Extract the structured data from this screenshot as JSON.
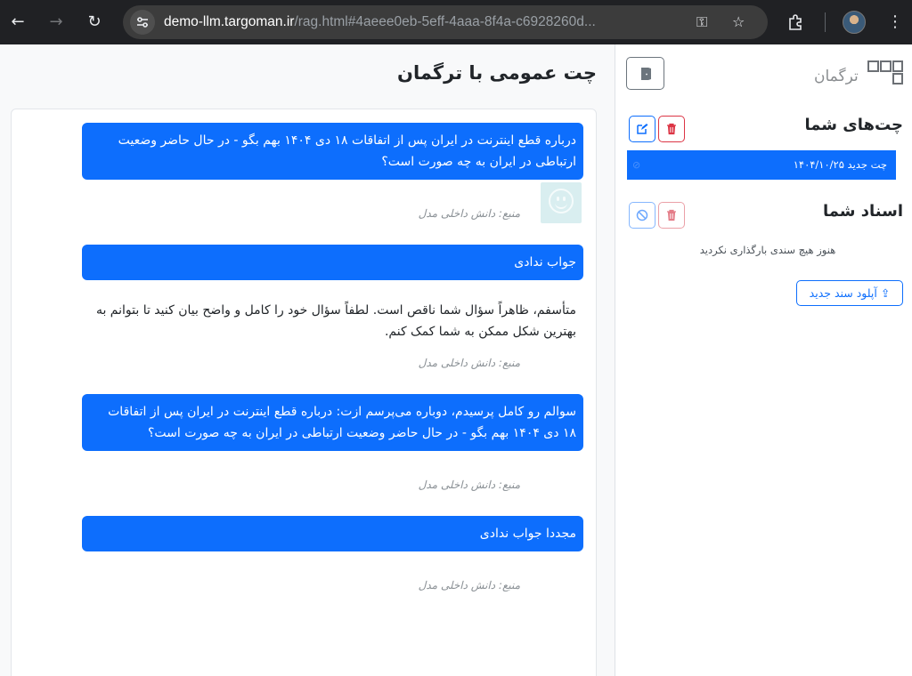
{
  "browser": {
    "url_host": "demo-llm.targoman.ir",
    "url_path": "/rag.html#4aeee0eb-5eff-4aaa-8f4a-c6928260d..."
  },
  "sidebar": {
    "logo_text": "ترگمان",
    "chats_title": "چت‌های شما",
    "chat_items": [
      {
        "label": "چت جدید ۱۴۰۴/۱۰/۲۵"
      }
    ],
    "docs_title": "اسناد شما",
    "docs_empty": "هنوز هیچ سندی بارگذاری نکردید",
    "upload_label": "آپلود سند جدید"
  },
  "main": {
    "title": "چت عمومی با ترگمان",
    "messages": [
      {
        "role": "user",
        "text": "درباره قطع اینترنت در ایران پس از اتفاقات ۱۸ دی ۱۴۰۴ بهم بگو - در حال حاضر وضعیت ارتباطی در ایران به چه صورت است؟",
        "source": "منبع: دانش داخلی مدل"
      },
      {
        "role": "user",
        "text": "جواب ندادی"
      },
      {
        "role": "assistant",
        "text": "متأسفم، ظاهراً سؤال شما ناقص است. لطفاً سؤال خود را کامل و واضح بیان کنید تا بتوانم به بهترین شکل ممکن به شما کمک کنم.",
        "source": "منبع: دانش داخلی مدل"
      },
      {
        "role": "user",
        "text": "سوالم رو کامل پرسیدم، دوباره می‌پرسم ازت: درباره قطع اینترنت در ایران پس از اتفاقات ۱۸ دی ۱۴۰۴ بهم بگو - در حال حاضر وضعیت ارتباطی در ایران به چه صورت است؟",
        "source": "منبع: دانش داخلی مدل"
      },
      {
        "role": "user",
        "text": "مجددا جواب ندادی",
        "source": "منبع: دانش داخلی مدل"
      }
    ]
  },
  "colors": {
    "primary": "#0d6efd",
    "danger": "#dc3545"
  }
}
